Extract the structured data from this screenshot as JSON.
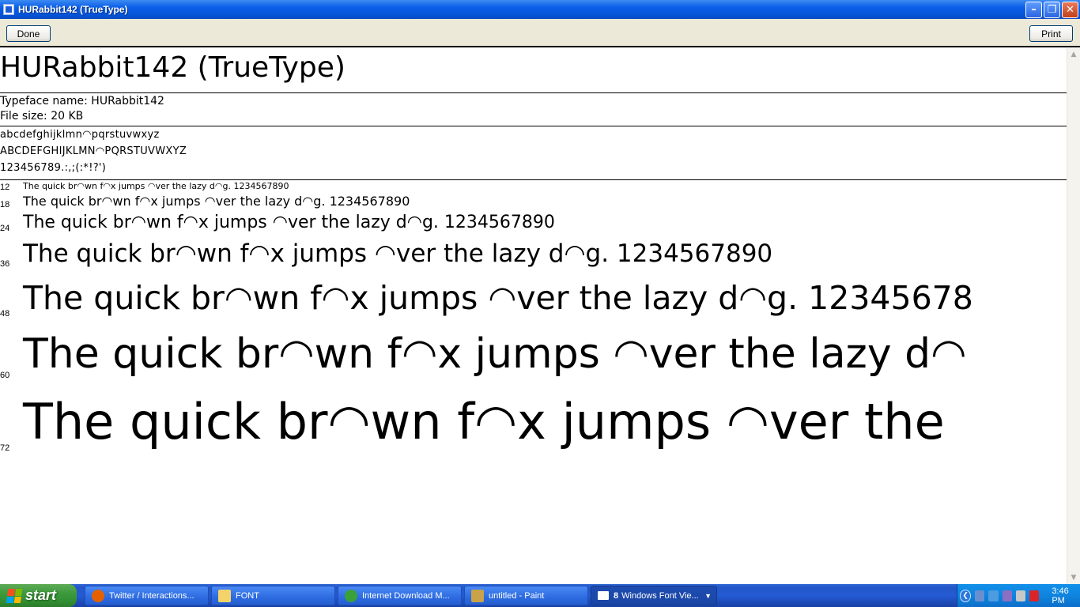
{
  "window": {
    "title": "HURabbit142 (TrueType)"
  },
  "toolbar": {
    "done_label": "Done",
    "print_label": "Print"
  },
  "font": {
    "heading": "HURabbit142 (TrueType)",
    "typeface_line": "Typeface name: HURabbit142",
    "filesize_line": "File size:  20 KB",
    "charset": {
      "lowercase": "abcdefghijklmn◠pqrstuvwxyz",
      "uppercase": "ABCDEFGHIJKLMN◠PQRSTUVWXYZ",
      "digits": "123456789.:,;(:*!?')"
    }
  },
  "samples": [
    {
      "size": "12",
      "text": "The quick br◠wn f◠x jumps ◠ver the lazy d◠g. 1234567890"
    },
    {
      "size": "18",
      "text": "The quick br◠wn f◠x jumps ◠ver the lazy d◠g. 1234567890"
    },
    {
      "size": "24",
      "text": "The quick br◠wn f◠x jumps ◠ver the lazy d◠g. 1234567890"
    },
    {
      "size": "36",
      "text": "The quick br◠wn f◠x jumps ◠ver the lazy d◠g. 1234567890"
    },
    {
      "size": "48",
      "text": "The quick br◠wn f◠x jumps ◠ver the lazy d◠g. 12345678"
    },
    {
      "size": "60",
      "text": "The quick br◠wn f◠x jumps ◠ver the lazy d◠"
    },
    {
      "size": "72",
      "text": "The quick br◠wn f◠x jumps ◠ver the"
    }
  ],
  "taskbar": {
    "start_label": "start",
    "tasks": [
      {
        "label": "Twitter / Interactions...",
        "icon": "firefox-icon",
        "color": "#e66000"
      },
      {
        "label": "FONT",
        "icon": "folder-icon",
        "color": "#f5d36b"
      },
      {
        "label": "Internet Download M...",
        "icon": "download-manager-icon",
        "color": "#3aa13a"
      },
      {
        "label": "untitled - Paint",
        "icon": "paint-icon",
        "color": "#c9a24a"
      },
      {
        "label": "Windows Font Vie...",
        "badge": "8",
        "icon": "font-viewer-icon",
        "color": "#ffffff"
      }
    ],
    "clock": "3:46 PM"
  }
}
